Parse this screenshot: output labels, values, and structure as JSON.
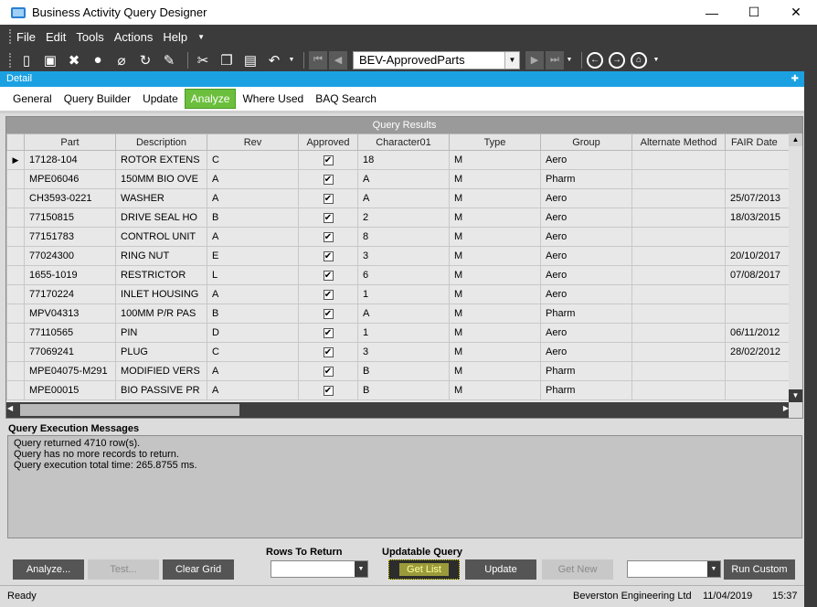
{
  "window": {
    "title": "Business Activity Query Designer",
    "minimize_glyph": "—",
    "maximize_glyph": "☐",
    "close_glyph": "✕"
  },
  "menu": [
    "File",
    "Edit",
    "Tools",
    "Actions",
    "Help"
  ],
  "toolbar": {
    "query_selector_value": "BEV-ApprovedParts",
    "icons": [
      "new-icon",
      "save-icon",
      "delete-icon",
      "chat-icon",
      "attach-icon",
      "refresh-icon",
      "clear-icon",
      "cut-icon",
      "copy-icon",
      "paste-icon",
      "undo-icon",
      "first-record-icon",
      "previous-record-icon",
      "next-record-icon",
      "last-record-icon",
      "back-icon",
      "forward-icon",
      "home-icon"
    ]
  },
  "detail_bar": {
    "label": "Detail"
  },
  "tabs": [
    {
      "label": "General",
      "active": false
    },
    {
      "label": "Query Builder",
      "active": false
    },
    {
      "label": "Update",
      "active": false
    },
    {
      "label": "Analyze",
      "active": true
    },
    {
      "label": "Where Used",
      "active": false
    },
    {
      "label": "BAQ Search",
      "active": false
    }
  ],
  "grid": {
    "caption": "Query Results",
    "columns": [
      "Part",
      "Description",
      "Rev",
      "Approved",
      "Character01",
      "Type",
      "Group",
      "Alternate Method",
      "FAIR Date"
    ],
    "rows": [
      [
        "17128-104",
        "ROTOR EXTENS",
        "C",
        true,
        "18",
        "M",
        "Aero",
        "",
        ""
      ],
      [
        "MPE06046",
        "150MM BIO OVE",
        "A",
        true,
        "A",
        "M",
        "Pharm",
        "",
        ""
      ],
      [
        "CH3593-0221",
        "WASHER",
        "A",
        true,
        "A",
        "M",
        "Aero",
        "",
        "25/07/2013"
      ],
      [
        "77150815",
        "DRIVE SEAL HO",
        "B",
        true,
        "2",
        "M",
        "Aero",
        "",
        "18/03/2015"
      ],
      [
        "77151783",
        "CONTROL UNIT",
        "A",
        true,
        "8",
        "M",
        "Aero",
        "",
        ""
      ],
      [
        "77024300",
        "RING NUT",
        "E",
        true,
        "3",
        "M",
        "Aero",
        "",
        "20/10/2017"
      ],
      [
        "1655-1019",
        "RESTRICTOR",
        "L",
        true,
        "6",
        "M",
        "Aero",
        "",
        "07/08/2017"
      ],
      [
        "77170224",
        "INLET HOUSING",
        "A",
        true,
        "1",
        "M",
        "Aero",
        "",
        ""
      ],
      [
        "MPV04313",
        "100MM P/R PAS",
        "B",
        true,
        "A",
        "M",
        "Pharm",
        "",
        ""
      ],
      [
        "77110565",
        "PIN",
        "D",
        true,
        "1",
        "M",
        "Aero",
        "",
        "06/11/2012"
      ],
      [
        "77069241",
        "PLUG",
        "C",
        true,
        "3",
        "M",
        "Aero",
        "",
        "28/02/2012"
      ],
      [
        "MPE04075-M291",
        "MODIFIED VERS",
        "A",
        true,
        "B",
        "M",
        "Pharm",
        "",
        ""
      ],
      [
        "MPE00015",
        "BIO PASSIVE PR",
        "A",
        true,
        "B",
        "M",
        "Pharm",
        "",
        ""
      ]
    ]
  },
  "messages": {
    "title": "Query Execution Messages",
    "lines": [
      "Query returned 4710 row(s).",
      "Query has no more records to return.",
      "Query execution total time: 265.8755 ms."
    ]
  },
  "buttons": {
    "analyze": "Analyze...",
    "test": "Test...",
    "clear_grid": "Clear Grid",
    "get_list": "Get List",
    "update": "Update",
    "get_new": "Get New",
    "run_custom": "Run Custom"
  },
  "rows_to_return": {
    "label": "Rows To Return",
    "value": ""
  },
  "updatable_query": {
    "label": "Updatable Query"
  },
  "custom_action": {
    "value": ""
  },
  "status": {
    "text": "Ready",
    "company": "Beverston Engineering Ltd",
    "date": "11/04/2019",
    "time": "15:37"
  },
  "colors": {
    "accent": "#1ba1e2",
    "active_tab": "#6cbf3c",
    "dark_chrome": "#3b3b3b"
  }
}
